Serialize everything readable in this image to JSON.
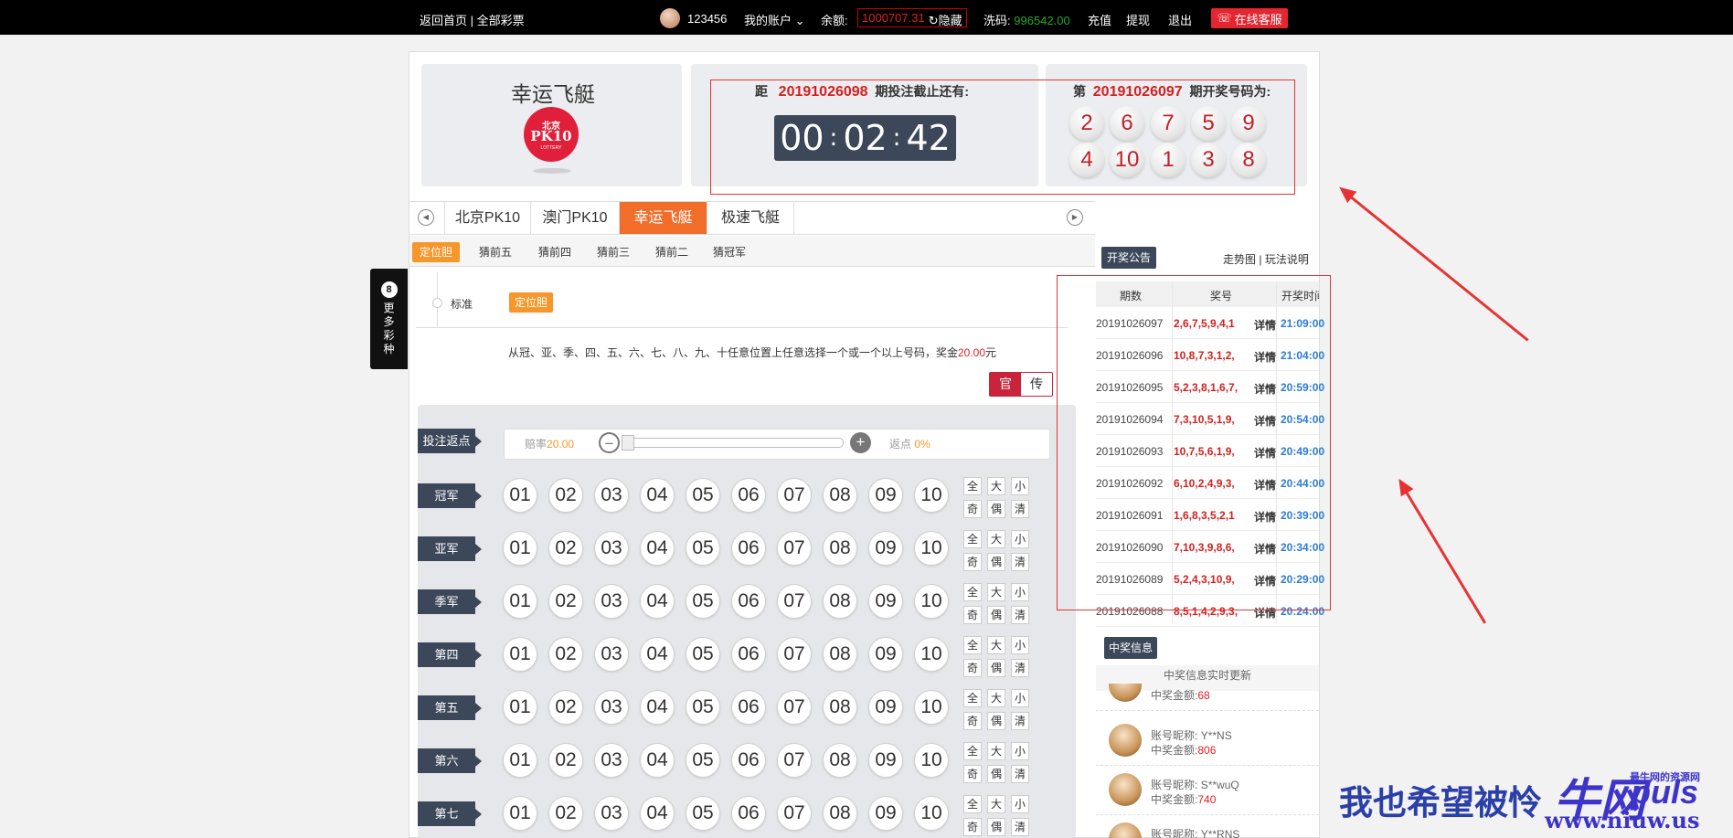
{
  "topbar": {
    "home_link": "返回首页",
    "sep": " | ",
    "all_lottery": "全部彩票",
    "username": "123456",
    "my_account": "我的账户",
    "balance_label": "余额:",
    "balance_value": "1000707.31",
    "hide": "隐藏",
    "rebate_label": "洗码:",
    "rebate_value": "996542.00",
    "recharge": "充值",
    "withdraw": "提现",
    "logout": "退出",
    "service": "在线客服"
  },
  "game": {
    "title": "幸运飞艇",
    "logo_top": "北京",
    "logo_main": "PK10",
    "logo_sub": "LOTTERY"
  },
  "countdown": {
    "prefix": "距",
    "issue": "20191026098",
    "suffix": "期投注截止还有:",
    "hh": "00",
    "mm": "02",
    "ss": "42"
  },
  "draw": {
    "prefix": "第",
    "issue": "20191026097",
    "suffix": "期开奖号码为:",
    "numbers": [
      "2",
      "6",
      "7",
      "5",
      "9",
      "4",
      "10",
      "1",
      "3",
      "8"
    ]
  },
  "game_tabs": [
    "北京PK10",
    "澳门PK10",
    "幸运飞艇",
    "极速飞艇"
  ],
  "sub_tabs": [
    "定位胆",
    "猜前五",
    "猜前四",
    "猜前三",
    "猜前二",
    "猜冠军"
  ],
  "standard_label": "标准",
  "standard_btn": "定位胆",
  "description": {
    "text": "从冠、亚、季、四、五、六、七、八、九、十任意位置上任意选择一个或一个以上号码，奖金",
    "amount": "20.00",
    "unit": "元"
  },
  "mode_toggle": {
    "official": "官",
    "traditional": "传"
  },
  "rebate_row": {
    "label": "投注返点",
    "odds_label": "赔率",
    "odds_value": "20.00",
    "rebate_label": "返点",
    "rebate_value": "0%"
  },
  "positions": [
    "冠军",
    "亚军",
    "季军",
    "第四",
    "第五",
    "第六",
    "第七"
  ],
  "numbers": [
    "01",
    "02",
    "03",
    "04",
    "05",
    "06",
    "07",
    "08",
    "09",
    "10"
  ],
  "quick": [
    "全",
    "大",
    "小",
    "奇",
    "偶",
    "清"
  ],
  "more_lottery": {
    "badge": "8",
    "text": "更多彩种"
  },
  "results": {
    "header": "开奖公告",
    "trend": "走势图",
    "sep": " | ",
    "rules": "玩法说明",
    "col_issue": "期数",
    "col_numbers": "奖号",
    "col_time": "开奖时间",
    "detail": "详情",
    "rows": [
      {
        "issue": "20191026097",
        "nums": "2,6,7,5,9,4,1",
        "time": "21:09:00"
      },
      {
        "issue": "20191026096",
        "nums": "10,8,7,3,1,2,",
        "time": "21:04:00"
      },
      {
        "issue": "20191026095",
        "nums": "5,2,3,8,1,6,7,",
        "time": "20:59:00"
      },
      {
        "issue": "20191026094",
        "nums": "7,3,10,5,1,9,",
        "time": "20:54:00"
      },
      {
        "issue": "20191026093",
        "nums": "10,7,5,6,1,9,",
        "time": "20:49:00"
      },
      {
        "issue": "20191026092",
        "nums": "6,10,2,4,9,3,",
        "time": "20:44:00"
      },
      {
        "issue": "20191026091",
        "nums": "1,6,8,3,5,2,1",
        "time": "20:39:00"
      },
      {
        "issue": "20191026090",
        "nums": "7,10,3,9,8,6,",
        "time": "20:34:00"
      },
      {
        "issue": "20191026089",
        "nums": "5,2,4,3,10,9,",
        "time": "20:29:00"
      },
      {
        "issue": "20191026088",
        "nums": "8,5,1,4,2,9,3,",
        "time": "20:24:00"
      }
    ]
  },
  "winners": {
    "header": "中奖信息",
    "sub": "中奖信息实时更新",
    "nick_label": "账号昵称:",
    "amount_label": "中奖金额:",
    "items": [
      {
        "nick": "",
        "amount": "68"
      },
      {
        "nick": "Y**NS",
        "amount": "806"
      },
      {
        "nick": "S**wuQ",
        "amount": "740"
      },
      {
        "nick": "Y**RNS",
        "amount": ""
      }
    ]
  },
  "watermark": {
    "text": "我也希望被怜",
    "logo_a": "牛网",
    "logo_b": "puls",
    "small": "最牛网的资源网",
    "url": "www.niuw.us"
  },
  "colors": {
    "accent": "#f06d2a",
    "red": "#e53333",
    "dark": "#3c4859"
  }
}
